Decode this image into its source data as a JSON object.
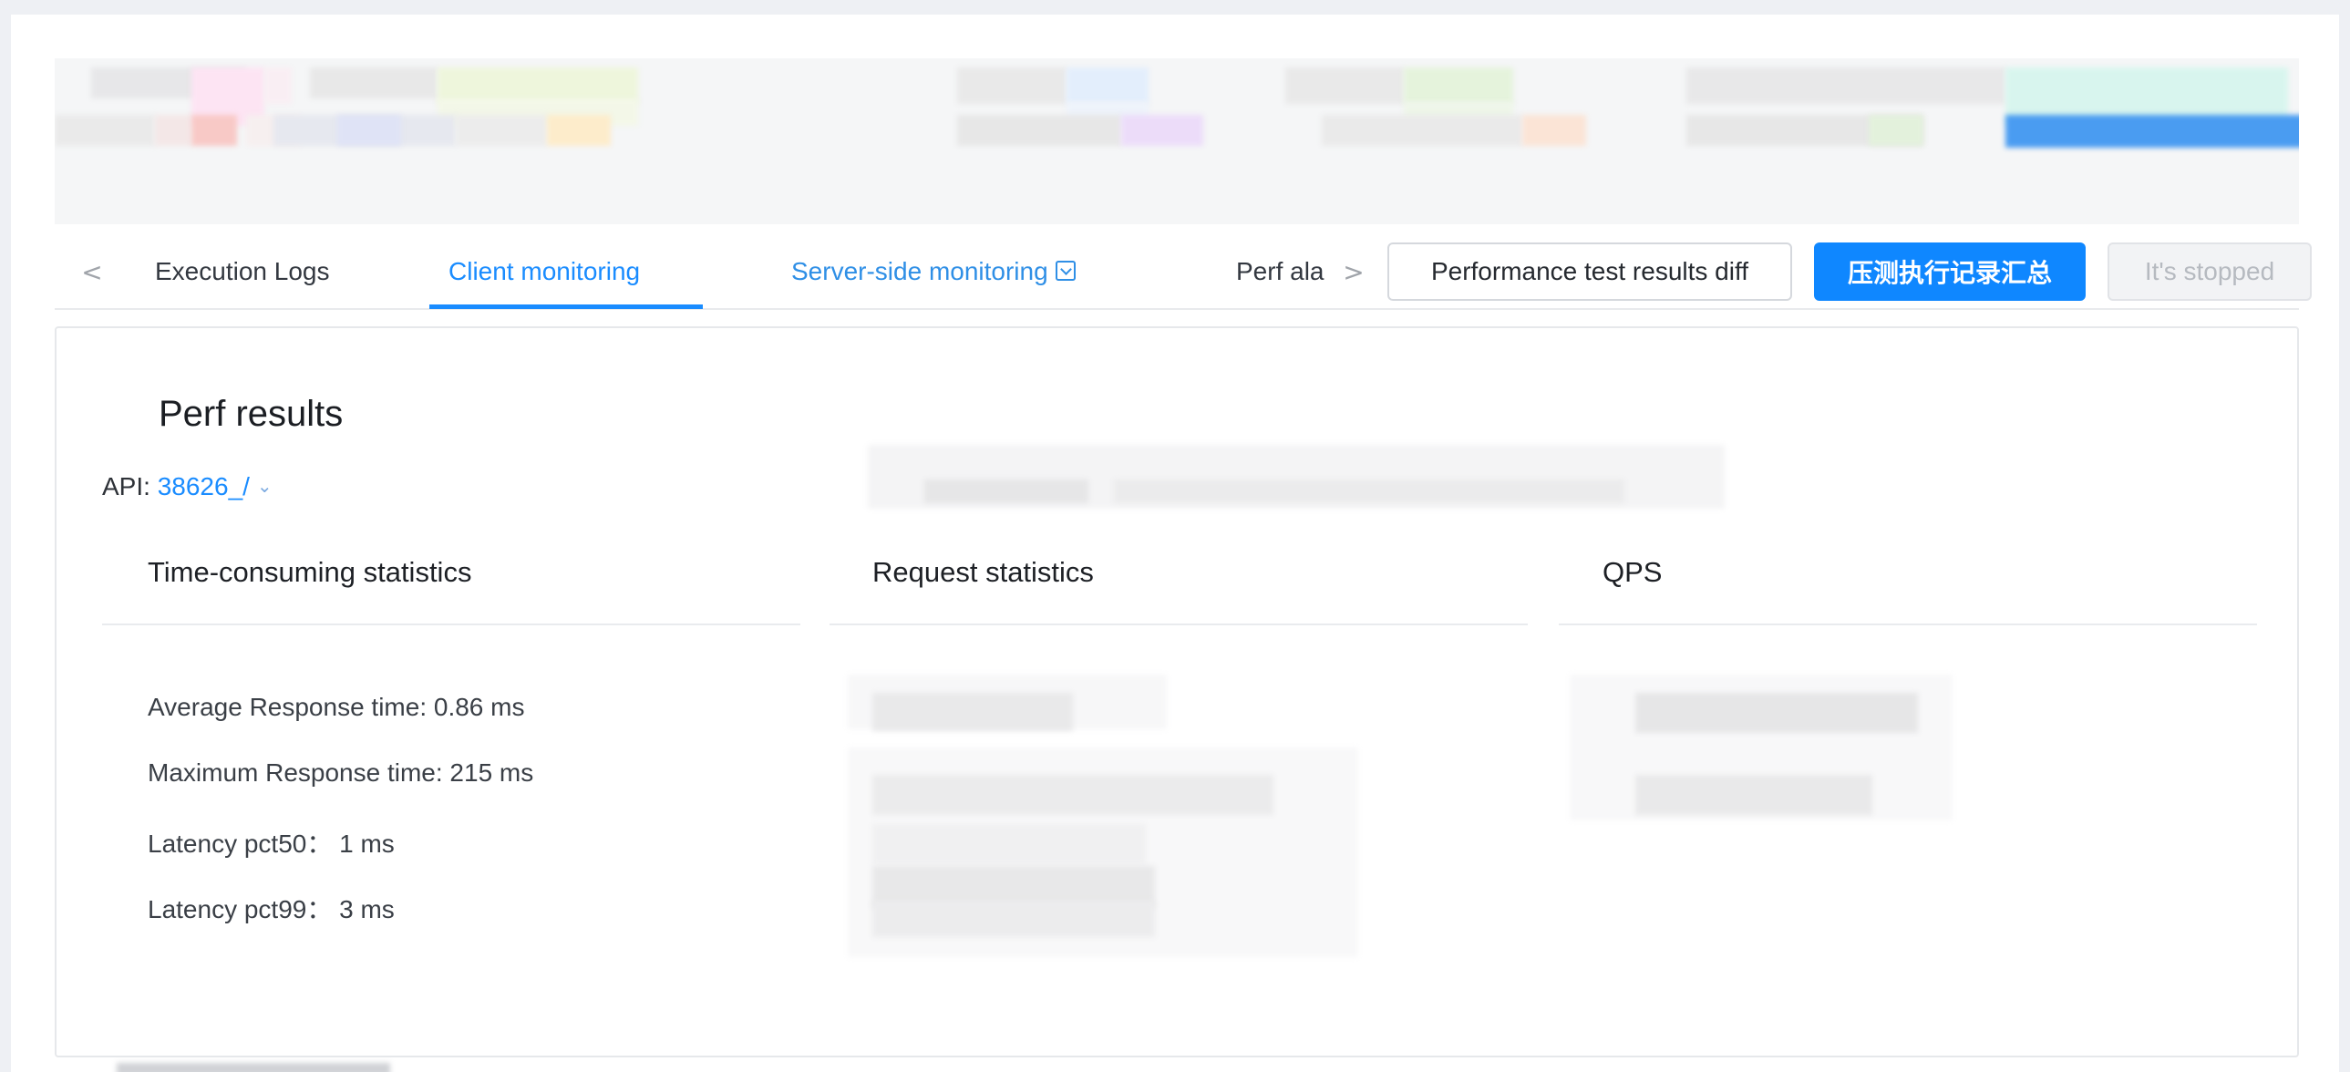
{
  "tabs": {
    "prev_arrow": "<",
    "next_arrow": ">",
    "items": [
      {
        "label": "Execution Logs"
      },
      {
        "label": "Client monitoring"
      },
      {
        "label": "Server-side monitoring"
      },
      {
        "label": "Perf ala"
      }
    ]
  },
  "toolbar": {
    "diff_button": "Performance test results diff",
    "summary_button": "压测执行记录汇总",
    "stopped_button": "It's stopped"
  },
  "card": {
    "title": "Perf results",
    "api_label": "API:",
    "api_value": "38626_/",
    "columns": [
      {
        "title": "Time-consuming statistics"
      },
      {
        "title": "Request statistics"
      },
      {
        "title": "QPS"
      }
    ],
    "stats": [
      "Average Response time: 0.86 ms",
      "Maximum Response time: 215 ms",
      "Latency pct50： 1 ms",
      "Latency pct99： 3 ms"
    ]
  },
  "colors": {
    "accent": "#0f87ff",
    "tab_active": "#1a8cff",
    "link": "#2f8fe6"
  },
  "icons": {
    "dropdown_chevron": "chevron-down-icon",
    "server_monitor_box": "dropdown-box-icon"
  }
}
